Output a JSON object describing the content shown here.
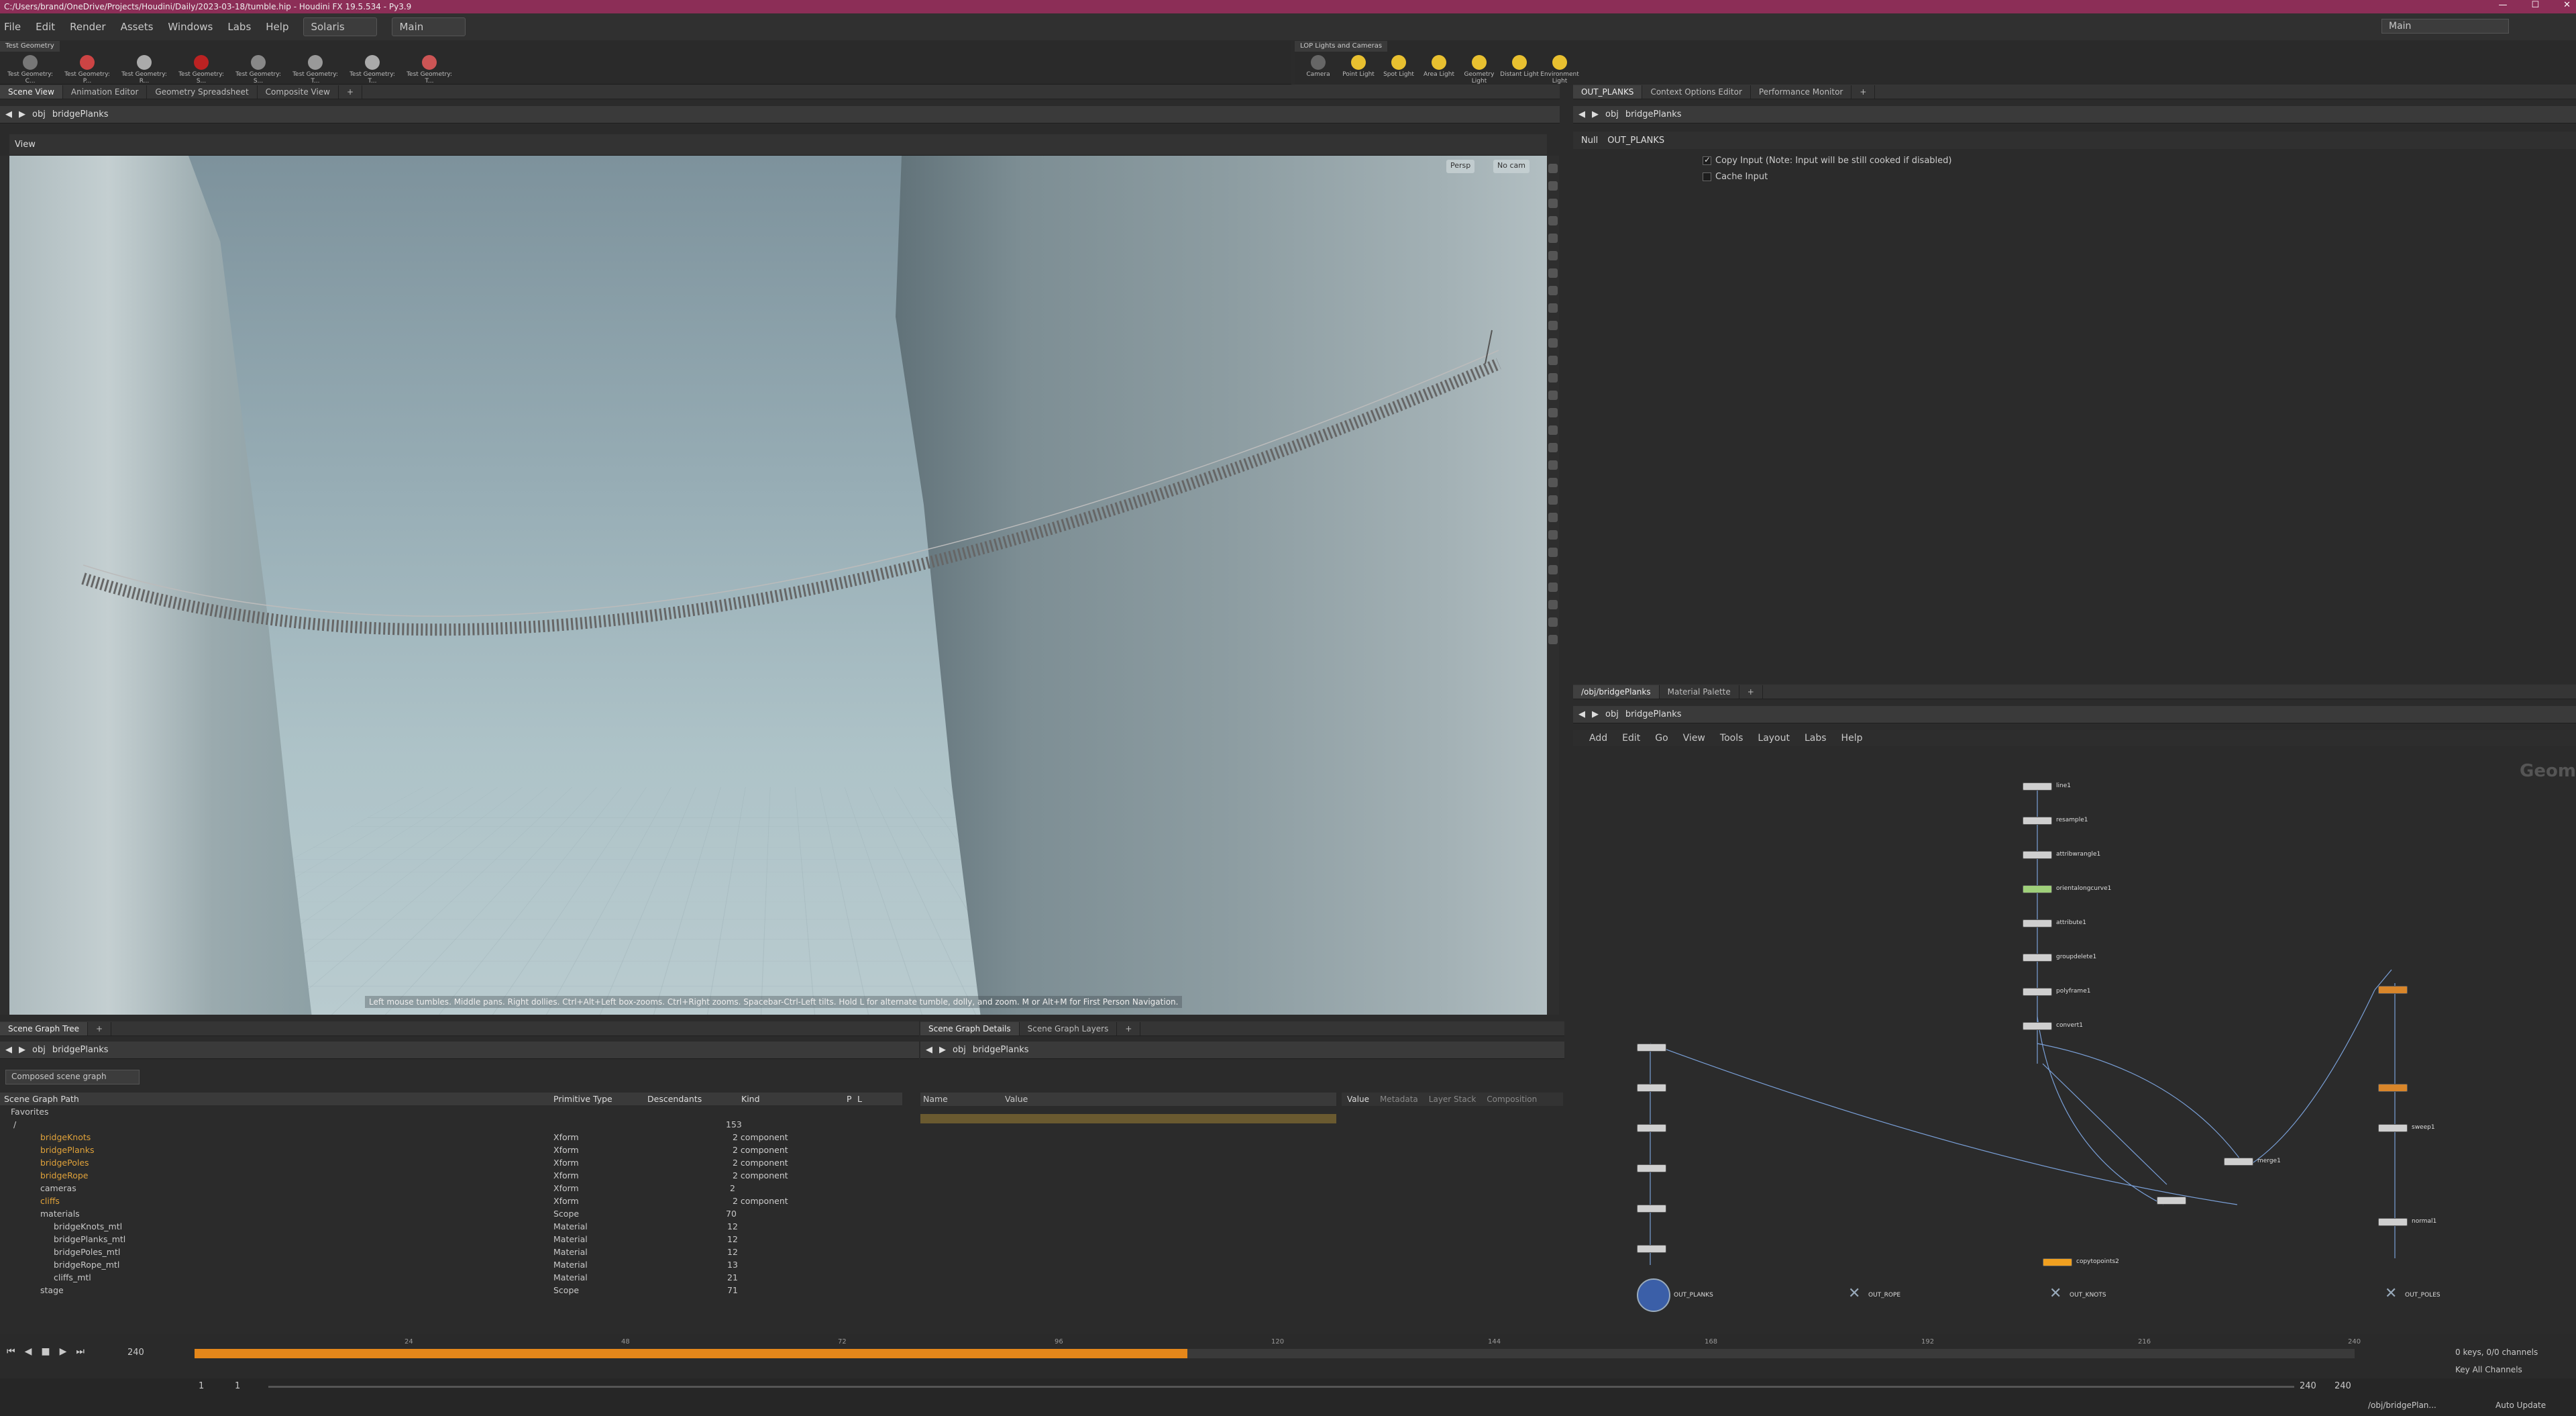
{
  "window": {
    "title": "C:/Users/brand/OneDrive/Projects/Houdini/Daily/2023-03-18/tumble.hip - Houdini FX 19.5.534 - Py3.9",
    "desktop": "Main"
  },
  "menu": {
    "items": [
      "File",
      "Edit",
      "Render",
      "Assets",
      "Windows",
      "Labs",
      "Help"
    ],
    "context": "Solaris",
    "desktop": "Main"
  },
  "shelf_left": {
    "tab": "Test Geometry",
    "tools": [
      "Test Geometry: C...",
      "Test Geometry: P...",
      "Test Geometry: R...",
      "Test Geometry: S...",
      "Test Geometry: S...",
      "Test Geometry: T...",
      "Test Geometry: T...",
      "Test Geometry: T..."
    ]
  },
  "shelf_right": {
    "tab": "LOP Lights and Cameras",
    "tools": [
      "Camera",
      "Point Light",
      "Spot Light",
      "Area Light",
      "Geometry Light",
      "Distant Light",
      "Environment Light"
    ]
  },
  "left_tabs": [
    "Scene View",
    "Animation Editor",
    "Geometry Spreadsheet",
    "Composite View"
  ],
  "right_top_tabs": [
    "OUT_PLANKS",
    "Context Options Editor",
    "Performance Monitor"
  ],
  "path": {
    "obj": "obj",
    "node": "bridgePlanks"
  },
  "viewport": {
    "label": "View",
    "persp": "Persp",
    "cam": "No cam",
    "hint": "Left mouse tumbles. Middle pans. Right dollies. Ctrl+Alt+Left box-zooms. Ctrl+Right zooms. Spacebar-Ctrl-Left tilts. Hold L for alternate tumble, dolly, and zoom.    M or Alt+M for First Person Navigation."
  },
  "params": {
    "type": "Null",
    "name": "OUT_PLANKS",
    "copy_input": "Copy Input (Note: Input will be still cooked if disabled)",
    "cache_input": "Cache Input"
  },
  "scene_graph": {
    "tabs": [
      "Scene Graph Tree"
    ],
    "filter": "Composed scene graph",
    "headers": [
      "Scene Graph Path",
      "Primitive Type",
      "Descendants",
      "Kind",
      "P",
      "L"
    ],
    "favorites": "Favorites",
    "rows": [
      {
        "name": "/",
        "type": "",
        "desc": "153",
        "kind": ""
      },
      {
        "name": "bridgeKnots",
        "type": "Xform",
        "desc": "",
        "kind": "2 component"
      },
      {
        "name": "bridgePlanks",
        "type": "Xform",
        "desc": "",
        "kind": "2 component"
      },
      {
        "name": "bridgePoles",
        "type": "Xform",
        "desc": "",
        "kind": "2 component"
      },
      {
        "name": "bridgeRope",
        "type": "Xform",
        "desc": "",
        "kind": "2 component"
      },
      {
        "name": "cameras",
        "type": "Xform",
        "desc": "2",
        "kind": ""
      },
      {
        "name": "cliffs",
        "type": "Xform",
        "desc": "",
        "kind": "2 component"
      },
      {
        "name": "materials",
        "type": "Scope",
        "desc": "70",
        "kind": ""
      },
      {
        "name": "bridgeKnots_mtl",
        "type": "Material",
        "desc": "12",
        "kind": ""
      },
      {
        "name": "bridgePlanks_mtl",
        "type": "Material",
        "desc": "12",
        "kind": ""
      },
      {
        "name": "bridgePoles_mtl",
        "type": "Material",
        "desc": "12",
        "kind": ""
      },
      {
        "name": "bridgeRope_mtl",
        "type": "Material",
        "desc": "13",
        "kind": ""
      },
      {
        "name": "cliffs_mtl",
        "type": "Material",
        "desc": "21",
        "kind": ""
      },
      {
        "name": "stage",
        "type": "Scope",
        "desc": "71",
        "kind": ""
      }
    ]
  },
  "details": {
    "tabs": [
      "Scene Graph Details",
      "Scene Graph Layers"
    ],
    "cols": [
      "Name",
      "Value"
    ],
    "side_tabs": [
      "Value",
      "Metadata",
      "Layer Stack",
      "Composition"
    ]
  },
  "network": {
    "tabs": [
      "/obj/bridgePlanks",
      "Material Palette"
    ],
    "menu": [
      "Add",
      "Edit",
      "Go",
      "View",
      "Tools",
      "Layout",
      "Labs",
      "Help"
    ],
    "context_label": "Geometry",
    "nodes": [
      "line1",
      "resample1",
      "attribwrangle1",
      "orientalongcurve1",
      "attribute1",
      "groupdelete1",
      "polyframe1",
      "convert1",
      "OUT_PLANKS",
      "OUT_ROPE",
      "OUT_KNOTS",
      "OUT_POLES",
      "copytopoints2",
      "merge1",
      "sweep1",
      "normal1"
    ]
  },
  "timeline": {
    "frame": "240",
    "ticks": [
      "24",
      "48",
      "72",
      "96",
      "120",
      "144",
      "168",
      "192",
      "216",
      "240"
    ],
    "start": "1",
    "start2": "1",
    "end": "240",
    "end2": "240",
    "keys": "0 keys, 0/0 channels",
    "key_all": "Key All Channels",
    "auto_update": "Auto Update",
    "status": "/obj/bridgePlan..."
  }
}
